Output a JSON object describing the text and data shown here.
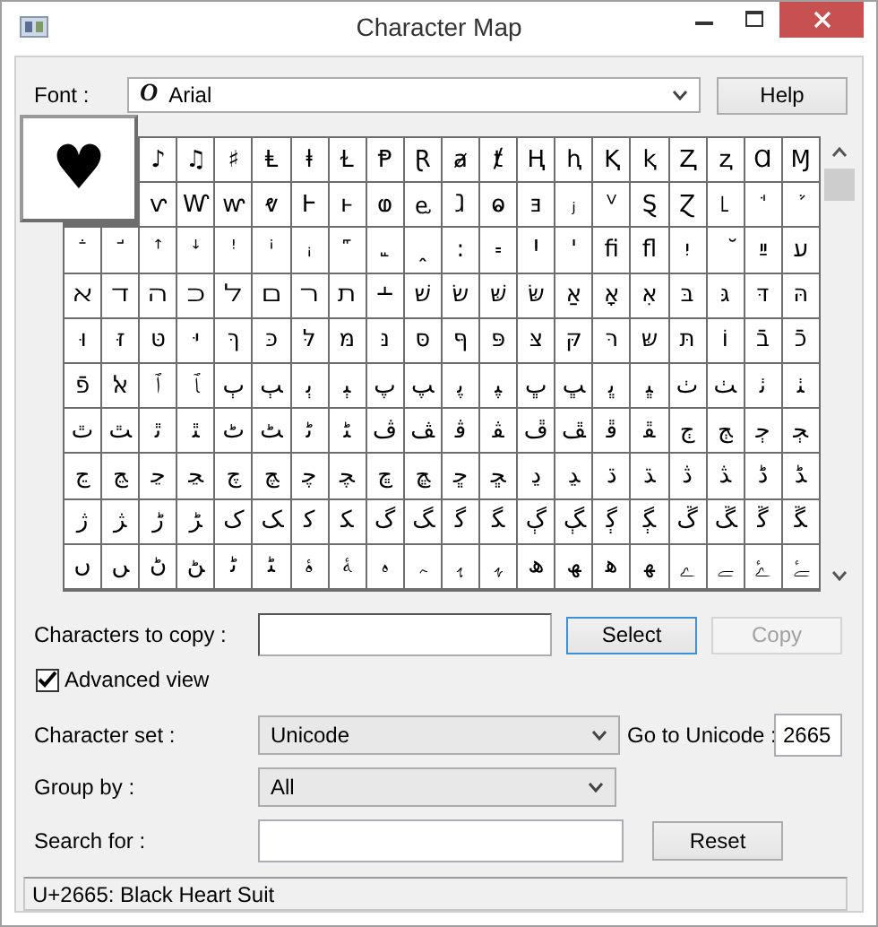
{
  "window": {
    "title": "Character Map"
  },
  "font": {
    "label": "Font :",
    "value": "Arial",
    "font_icon": "O",
    "help": "Help"
  },
  "magnified": "♥",
  "grid": {
    "rows": [
      {
        "cells": [
          "♪",
          "♫",
          "♯",
          "Ⱡ",
          "ⱡ",
          "Ɫ",
          "Ᵽ",
          "Ɽ",
          "ⱥ",
          "ⱦ",
          "Ⱨ",
          "ⱨ",
          "Ⱪ",
          "ⱪ",
          "Ⱬ",
          "ⱬ",
          "Ɑ",
          "Ɱ"
        ]
      },
      {
        "cells": [
          "ⱱ",
          "Ⱳ",
          "ⱳ",
          "ⱴ",
          "Ⱶ",
          "ⱶ",
          "ⱷ",
          "ⱸ",
          "ⱹ",
          "ⱺ",
          "ⱻ",
          "ⱼ",
          "ⱽ",
          "Ȿ",
          "Ɀ",
          "꜖",
          "ꜗ",
          "ꜘ"
        ]
      },
      {
        "cells": [
          "ꜙ",
          "ꜚ",
          "ꜛ",
          "ꜜ",
          "ꜝ",
          "ꜞ",
          "ꜟ",
          "꜠",
          "꜡",
          "ꞈ",
          "꞉",
          "꞊",
          "Ꞌ",
          "ꞌ",
          "ﬁ",
          "ﬂ",
          "יִ",
          "ﬞ",
          "ײַ",
          "ﬠ"
        ]
      },
      {
        "cells": [
          "ﬡ",
          "ﬢ",
          "ﬣ",
          "ﬤ",
          "ﬥ",
          "ﬦ",
          "ﬧ",
          "ﬨ",
          "﬩",
          "שׁ",
          "שׂ",
          "שּׁ",
          "שּׂ",
          "אַ",
          "אָ",
          "אּ",
          "בּ",
          "גּ",
          "דּ",
          "הּ"
        ]
      },
      {
        "cells": [
          "וּ",
          "זּ",
          "טּ",
          "יּ",
          "ךּ",
          "כּ",
          "לּ",
          "מּ",
          "נּ",
          "סּ",
          "ףּ",
          "פּ",
          "צּ",
          "קּ",
          "רּ",
          "שּ",
          "תּ",
          "וֹ",
          "בֿ",
          "כֿ"
        ]
      },
      {
        "cells": [
          "פֿ",
          "ﭏ",
          "ﭐ",
          "ﭑ",
          "ﭒ",
          "ﭓ",
          "ﭔ",
          "ﭕ",
          "ﭖ",
          "ﭗ",
          "ﭘ",
          "ﭙ",
          "ﭚ",
          "ﭛ",
          "ﭜ",
          "ﭝ",
          "ﭞ",
          "ﭟ",
          "ﭠ",
          "ﭡ"
        ]
      },
      {
        "cells": [
          "ﭢ",
          "ﭣ",
          "ﭤ",
          "ﭥ",
          "ﭦ",
          "ﭧ",
          "ﭨ",
          "ﭩ",
          "ﭪ",
          "ﭫ",
          "ﭬ",
          "ﭭ",
          "ﭮ",
          "ﭯ",
          "ﭰ",
          "ﭱ",
          "ﭲ",
          "ﭳ",
          "ﭴ",
          "ﭵ"
        ]
      },
      {
        "cells": [
          "ﭶ",
          "ﭷ",
          "ﭸ",
          "ﭹ",
          "ﭺ",
          "ﭻ",
          "ﭼ",
          "ﭽ",
          "ﭾ",
          "ﭿ",
          "ﮀ",
          "ﮁ",
          "ﮂ",
          "ﮃ",
          "ﮄ",
          "ﮅ",
          "ﮆ",
          "ﮇ",
          "ﮈ",
          "ﮉ"
        ]
      },
      {
        "cells": [
          "ﮊ",
          "ﮋ",
          "ﮌ",
          "ﮍ",
          "ﮎ",
          "ﮏ",
          "ﮐ",
          "ﮑ",
          "ﮒ",
          "ﮓ",
          "ﮔ",
          "ﮕ",
          "ﮖ",
          "ﮗ",
          "ﮘ",
          "ﮙ",
          "ﮚ",
          "ﮛ",
          "ﮜ",
          "ﮝ"
        ]
      },
      {
        "cells": [
          "ﮞ",
          "ﮟ",
          "ﮠ",
          "ﮡ",
          "ﮢ",
          "ﮣ",
          "ﮤ",
          "ﮥ",
          "ﮦ",
          "ﮧ",
          "ﮨ",
          "ﮩ",
          "ﮪ",
          "ﮫ",
          "ﮬ",
          "ﮭ",
          "ﮮ",
          "ﮯ",
          "ﮰ",
          "ﮱ"
        ]
      }
    ]
  },
  "copy": {
    "label": "Characters to copy :",
    "buttons": [
      {
        "label": "Select",
        "disabled": false,
        "focused": true
      },
      {
        "label": "Copy",
        "disabled": true,
        "focused": false
      }
    ]
  },
  "advanced": {
    "label": "Advanced view",
    "checked": true
  },
  "charset": {
    "label": "Character set :",
    "value": "Unicode",
    "goto_label": "Go to Unicode :",
    "goto_value": "2665"
  },
  "group": {
    "label": "Group by :",
    "value": "All"
  },
  "search": {
    "label": "Search for :",
    "button": "Reset"
  },
  "status_bar": "U+2665: Black Heart Suit"
}
